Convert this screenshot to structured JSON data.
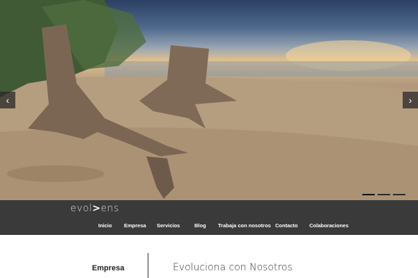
{
  "hero": {
    "image": "beach-driftwood-sunset-photo",
    "prev_icon": "‹",
    "next_icon": "›",
    "slides": [
      {
        "active": true
      },
      {
        "active": false
      },
      {
        "active": false
      }
    ]
  },
  "logo": {
    "prefix": "evol",
    "mark": ">",
    "suffix": "ens"
  },
  "nav": {
    "items": [
      "Inicio",
      "Empresa",
      "Servicios",
      "Blog",
      "Trabaja con nosotros",
      "Contacto",
      "Colaboraciones"
    ]
  },
  "content": {
    "sidebar_title": "Empresa",
    "title": "Evoluciona con Nosotros"
  }
}
